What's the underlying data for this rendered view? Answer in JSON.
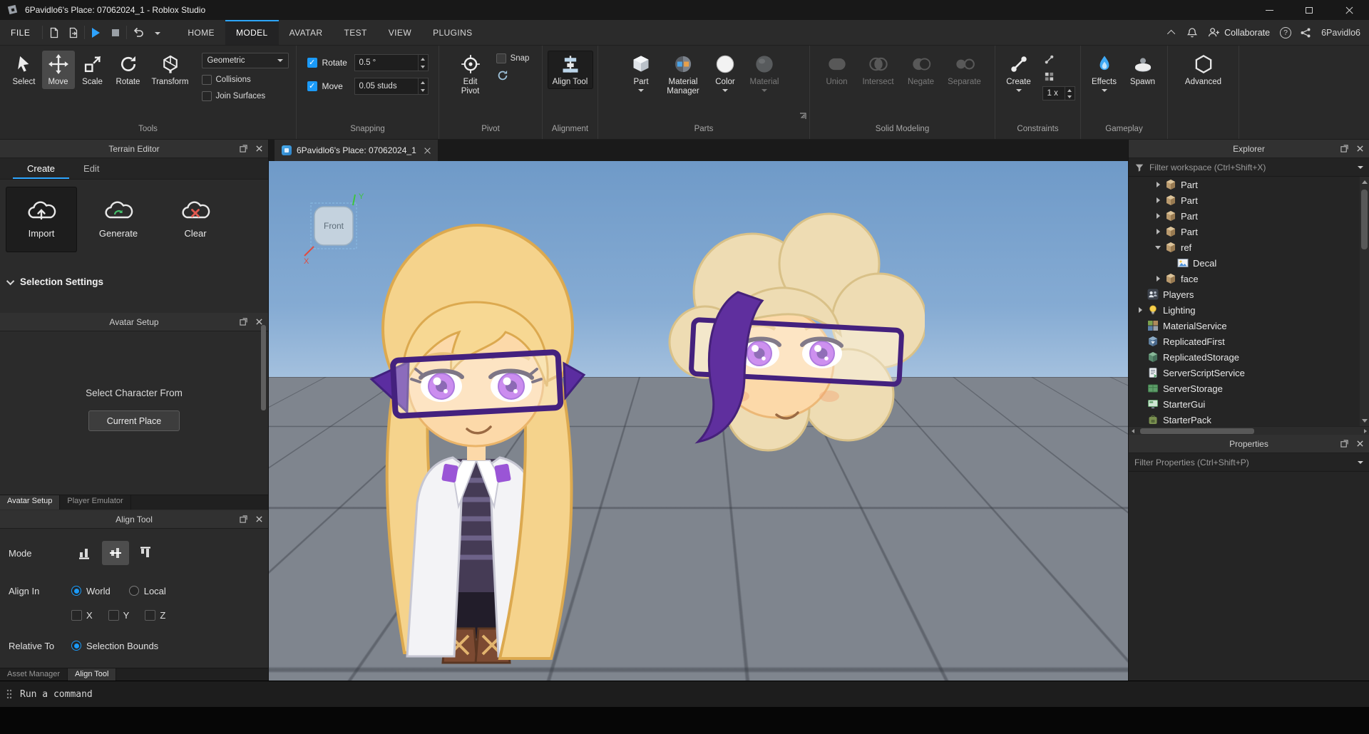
{
  "window": {
    "title": "6Pavidlo6's Place: 07062024_1 - Roblox Studio"
  },
  "menubar": {
    "file": "FILE",
    "tabs": [
      "HOME",
      "MODEL",
      "AVATAR",
      "TEST",
      "VIEW",
      "PLUGINS"
    ],
    "collaborate": "Collaborate",
    "username": "6Pavidlo6"
  },
  "ribbon": {
    "tools": {
      "label": "Tools",
      "select": "Select",
      "move": "Move",
      "scale": "Scale",
      "rotate": "Rotate",
      "transform": "Transform",
      "mode_dropdown": "Geometric",
      "collisions": "Collisions",
      "join_surfaces": "Join Surfaces"
    },
    "snapping": {
      "label": "Snapping",
      "rotate": "Rotate",
      "rotate_value": "0.5 °",
      "move": "Move",
      "move_value": "0.05 studs"
    },
    "pivot": {
      "label": "Pivot",
      "edit_pivot": "Edit Pivot",
      "snap": "Snap"
    },
    "alignment": {
      "label": "Alignment",
      "align_tool": "Align Tool"
    },
    "parts": {
      "label": "Parts",
      "part": "Part",
      "material_manager": "Material Manager",
      "color": "Color",
      "material": "Material"
    },
    "solid": {
      "label": "Solid Modeling",
      "union": "Union",
      "intersect": "Intersect",
      "negate": "Negate",
      "separate": "Separate"
    },
    "constraints": {
      "label": "Constraints",
      "create": "Create",
      "scale_value": "1 x"
    },
    "gameplay": {
      "label": "Gameplay",
      "effects": "Effects",
      "spawn": "Spawn",
      "advanced": "Advanced"
    }
  },
  "terrain": {
    "title": "Terrain Editor",
    "create_tab": "Create",
    "edit_tab": "Edit",
    "import": "Import",
    "generate": "Generate",
    "clear": "Clear",
    "selection_settings": "Selection Settings"
  },
  "avatar": {
    "title": "Avatar Setup",
    "prompt": "Select Character From",
    "current_place": "Current Place",
    "tab_avatar_setup": "Avatar Setup",
    "tab_player_emulator": "Player Emulator"
  },
  "align": {
    "title": "Align Tool",
    "mode": "Mode",
    "align_in": "Align In",
    "world": "World",
    "local": "Local",
    "x": "X",
    "y": "Y",
    "z": "Z",
    "relative_to": "Relative To",
    "selection_bounds": "Selection Bounds",
    "tab_asset_manager": "Asset Manager",
    "tab_align_tool": "Align Tool"
  },
  "viewport": {
    "tab": "6Pavidlo6's Place: 07062024_1",
    "front": "Front",
    "axis_x": "X",
    "axis_y": "Y"
  },
  "explorer": {
    "title": "Explorer",
    "filter": "Filter workspace (Ctrl+Shift+X)",
    "items": [
      {
        "label": "Part"
      },
      {
        "label": "Part"
      },
      {
        "label": "Part"
      },
      {
        "label": "Part"
      },
      {
        "label": "ref"
      },
      {
        "label": "Decal"
      },
      {
        "label": "face"
      },
      {
        "label": "Players"
      },
      {
        "label": "Lighting"
      },
      {
        "label": "MaterialService"
      },
      {
        "label": "ReplicatedFirst"
      },
      {
        "label": "ReplicatedStorage"
      },
      {
        "label": "ServerScriptService"
      },
      {
        "label": "ServerStorage"
      },
      {
        "label": "StarterGui"
      },
      {
        "label": "StarterPack"
      }
    ]
  },
  "properties": {
    "title": "Properties",
    "filter": "Filter Properties (Ctrl+Shift+P)"
  },
  "command": {
    "placeholder": "Run a command"
  },
  "colors": {
    "accent_blue": "#2da6ff",
    "check_bl ue": "#1b9af7",
    "sky_top": "#6f9ac8",
    "sky_horizon": "#cfe0ef",
    "ground": "#7f858e",
    "glasses_purple": "#44217e",
    "hair_blonde": "#f5d38c"
  }
}
